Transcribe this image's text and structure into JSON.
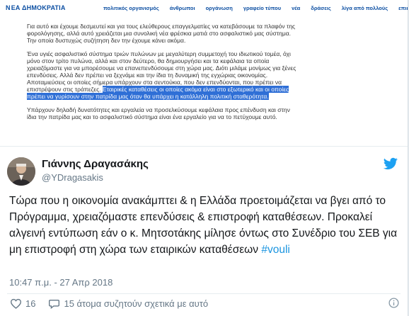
{
  "screenshot": {
    "logo": {
      "prefix": "Ν",
      "text": "ΕΑ ΔΗΜΟΚΡΑΤΙΑ"
    },
    "nav": [
      "πολιτικός οργανισμός",
      "άνθρωποι",
      "οργάνωση",
      "γραφείο τύπου",
      "νέα",
      "δράσεις",
      "λίγα από πολλούς",
      "επικοινων"
    ],
    "paragraphs": [
      {
        "lines": [
          {
            "text": "Για αυτό και έχουμε δεσμευτεί και για τους ελεύθερους επαγγελματίες να κατεβάσουμε τα πλαφόν της"
          },
          {
            "text": "φορολόγησης, αλλά αυτό χρειάζεται μια συνολική νέα φρέσκια ματιά στο ασφαλιστικό μας σύστημα."
          },
          {
            "text": "Την οποία δυστυχώς συζήτηση δεν την έχουμε κάνει ακόμα."
          }
        ]
      },
      {
        "lines": [
          {
            "text": "Ένα υγιές ασφαλιστικό σύστημα τριών πυλώνων με μεγαλύτερη συμμετοχή του ιδιωτικού τομέα, όχι"
          },
          {
            "text": "μόνο στον τρίτο πυλώνα, αλλά και στον δεύτερο, θα δημιουργήσει και τα κεφάλαια τα οποία"
          },
          {
            "text": "χρειαζόμαστε για να μπορέσουμε να επανεπενδύσουμε στη χώρα μας. Διότι μιλάμε μονίμως για ξένες"
          },
          {
            "text": "επενδύσεις. Αλλά δεν πρέπει να ξεχνάμε και την ίδια τη δυναμική της εγχώριας οικονομίας."
          },
          {
            "text": "Αποταμιεύσεις οι οποίες σήμερα υπάρχουν στα σεντούκια, που δεν επενδύονται, που πρέπει να"
          },
          {
            "text": "επιστρέψουν στις τράπεζες.",
            "highlight": "Εταιρικές καταθέσεις οι οποίες ακόμα είναι στο εξωτερικό και οι οποίες"
          },
          {
            "highlight": "πρέπει να γυρίσουν στην πατρίδα μας όταν θα υπάρχει η κατάλληλη πολιτική σταθερότητα."
          }
        ]
      },
      {
        "lines": [
          {
            "text": "Υπάρχουν δηλαδή δυνατότητες και εργαλεία να προσελκύσουμε κεφάλαια προς επένδυση και στην"
          },
          {
            "text": "ίδια την πατρίδα μας και το ασφαλιστικό σύστημα είναι ένα εργαλείο για να το πετύχουμε αυτό."
          }
        ]
      }
    ]
  },
  "tweet": {
    "author_name": "Γιάννης Δραγασάκης",
    "handle": "@YDragasakis",
    "text_before": "Τώρα που η οικονομία ανακάμπτει & η Ελλάδα προετοιμάζεται να βγει από το Πρόγραμμα, χρειαζόμαστε επενδύσεις & επιστροφή καταθέσεων. Προκαλεί αλγεινή εντύπωση εάν ο κ. Μητσοτάκης μίλησε όντως στο Συνέδριο του ΣΕΒ για μη επιστροφή στη χώρα των εταιρικών καταθέσεων ",
    "hashtag": "#vouli",
    "timestamp": "10:47 π.μ. - 27 Απρ 2018",
    "likes": "16",
    "replies_text": "15 άτομα συζητούν σχετικά με αυτό",
    "icons": {
      "bird": "twitter-bird-icon",
      "heart": "heart-icon",
      "reply": "reply-bubble-icon",
      "info": "info-icon"
    }
  },
  "colors": {
    "twitter_blue": "#1da1f2",
    "link_blue": "#1b95e0",
    "nd_blue": "#0b4ea2",
    "highlight": "#2f6fd6"
  }
}
